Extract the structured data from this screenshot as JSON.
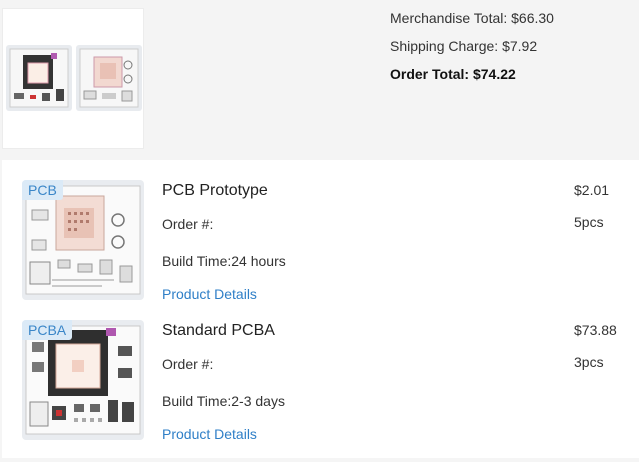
{
  "summary": {
    "merchandise_total": "Merchandise Total: $66.30",
    "shipping_charge": "Shipping Charge: $7.92",
    "order_total": "Order Total: $74.22"
  },
  "items": [
    {
      "tag": "PCB",
      "title": "PCB Prototype",
      "order_label": "Order #:",
      "build_time": "Build Time:24 hours",
      "details_link": "Product Details",
      "price": "$2.01",
      "quantity": "5pcs"
    },
    {
      "tag": "PCBA",
      "title": "Standard PCBA",
      "order_label": "Order #:",
      "build_time": "Build Time:2-3 days",
      "details_link": "Product Details",
      "price": "$73.88",
      "quantity": "3pcs"
    }
  ],
  "colors": {
    "link": "#2f7fc7",
    "tag_bg": "#dbeaf7",
    "tag_text": "#3a86c8",
    "summary_bg": "#f4f4f4"
  }
}
